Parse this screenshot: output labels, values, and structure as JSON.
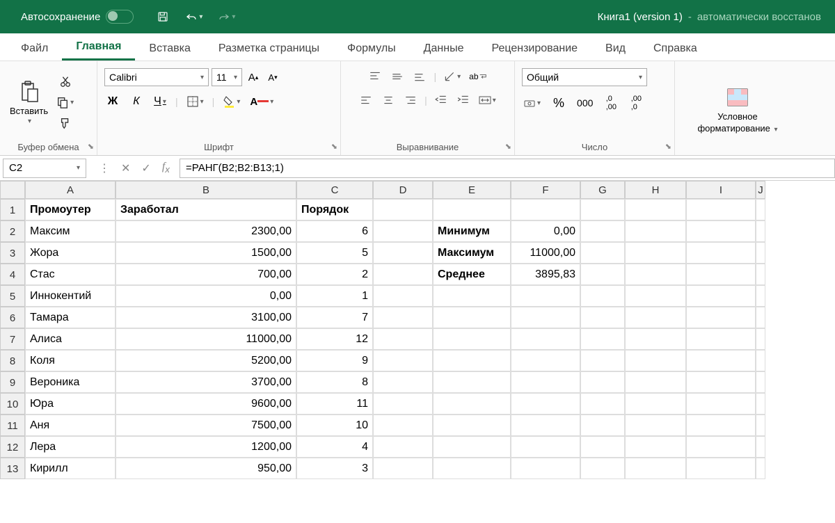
{
  "titlebar": {
    "autosave": "Автосохранение",
    "doc_name": "Книга1 (version 1)",
    "doc_sep": "-",
    "doc_status": "автоматически восстанов"
  },
  "tabs": [
    "Файл",
    "Главная",
    "Вставка",
    "Разметка страницы",
    "Формулы",
    "Данные",
    "Рецензирование",
    "Вид",
    "Справка"
  ],
  "active_tab": 1,
  "ribbon": {
    "clipboard": {
      "paste": "Вставить",
      "label": "Буфер обмена"
    },
    "font": {
      "name": "Calibri",
      "size": "11",
      "bold": "Ж",
      "italic": "К",
      "underline": "Ч",
      "label": "Шрифт"
    },
    "align": {
      "label": "Выравнивание",
      "wrap": "ab"
    },
    "number": {
      "format": "Общий",
      "label": "Число"
    },
    "cond": {
      "label": "Условное",
      "label2": "форматирование"
    }
  },
  "name_box": "C2",
  "formula": "=РАНГ(B2;B2:B13;1)",
  "columns": [
    "A",
    "B",
    "C",
    "D",
    "E",
    "F",
    "G",
    "H",
    "I",
    "J"
  ],
  "headers": {
    "A": "Промоутер",
    "B": "Заработал",
    "C": "Порядок"
  },
  "rows": [
    {
      "n": 1
    },
    {
      "n": 2,
      "A": "Максим",
      "B": "2300,00",
      "C": "6",
      "E": "Минимум",
      "F": "0,00"
    },
    {
      "n": 3,
      "A": "Жора",
      "B": "1500,00",
      "C": "5",
      "E": "Максимум",
      "F": "11000,00"
    },
    {
      "n": 4,
      "A": "Стас",
      "B": "700,00",
      "C": "2",
      "E": "Среднее",
      "F": "3895,83"
    },
    {
      "n": 5,
      "A": "Иннокентий",
      "B": "0,00",
      "C": "1"
    },
    {
      "n": 6,
      "A": "Тамара",
      "B": "3100,00",
      "C": "7"
    },
    {
      "n": 7,
      "A": "Алиса",
      "B": "11000,00",
      "C": "12"
    },
    {
      "n": 8,
      "A": "Коля",
      "B": "5200,00",
      "C": "9"
    },
    {
      "n": 9,
      "A": "Вероника",
      "B": "3700,00",
      "C": "8"
    },
    {
      "n": 10,
      "A": "Юра",
      "B": "9600,00",
      "C": "11"
    },
    {
      "n": 11,
      "A": "Аня",
      "B": "7500,00",
      "C": "10"
    },
    {
      "n": 12,
      "A": "Лера",
      "B": "1200,00",
      "C": "4"
    },
    {
      "n": 13,
      "A": "Кирилл",
      "B": "950,00",
      "C": "3"
    }
  ]
}
